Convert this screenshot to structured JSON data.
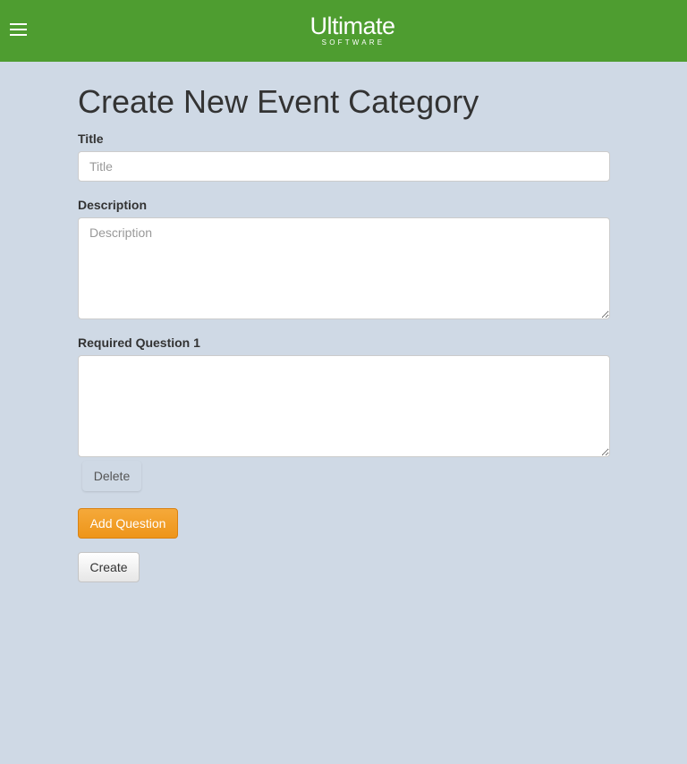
{
  "header": {
    "menu_icon": "hamburger-icon",
    "logo_main": "Ultimate",
    "logo_sub": "SOFTWARE",
    "bar_color": "#4e9d30"
  },
  "form": {
    "page_title": "Create New Event Category",
    "title_label": "Title",
    "title_placeholder": "Title",
    "title_value": "",
    "description_label": "Description",
    "description_placeholder": "Description",
    "description_value": "",
    "question_label": "Required Question 1",
    "question_value": "",
    "delete_label": "Delete",
    "add_question_label": "Add Question",
    "create_label": "Create"
  },
  "colors": {
    "background": "#cfd9e5",
    "accent_orange": "#f0a030"
  }
}
